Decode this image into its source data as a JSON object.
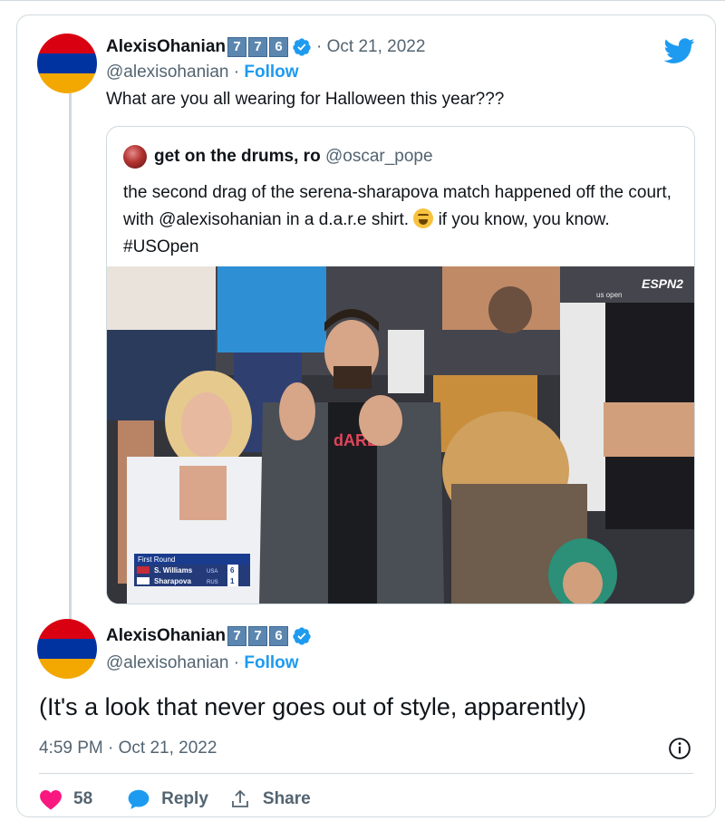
{
  "original_tweet": {
    "display_name": "AlexisOhanian",
    "number_badges": [
      "7",
      "7",
      "6"
    ],
    "handle": "@alexisohanian",
    "follow_label": "Follow",
    "date": "Oct 21, 2022",
    "text": "What are you all wearing for Halloween this year???",
    "quoted_tweet": {
      "display_name": "get on the drums, ro",
      "handle": "@oscar_pope",
      "text_before_emoji": "the second drag of the serena-sharapova match happened off the court, with @alexisohanian in a d.a.r.e shirt.",
      "text_after_emoji": "if you know, you know. #USOpen",
      "media": {
        "broadcast_logo": "ESPN2",
        "event_logo": "us open",
        "scoreboard": {
          "header": "First Round",
          "rows": [
            {
              "player": "S. Williams",
              "country": "USA",
              "score": "6"
            },
            {
              "player": "Sharapova",
              "country": "RUS",
              "score": "1"
            }
          ]
        },
        "shirt_text": "dARE"
      }
    }
  },
  "reply_tweet": {
    "display_name": "AlexisOhanian",
    "number_badges": [
      "7",
      "7",
      "6"
    ],
    "handle": "@alexisohanian",
    "follow_label": "Follow",
    "text": "(It's a look that never goes out of style, apparently)",
    "timestamp": "4:59 PM · Oct 21, 2022",
    "like_count": "58",
    "reply_label": "Reply",
    "share_label": "Share"
  },
  "colors": {
    "accent_blue": "#1d9bf0",
    "like_pink": "#f91880",
    "muted_text": "#536471",
    "badge_blue": "#5b86b0"
  },
  "icons": [
    "twitter-bird-icon",
    "verified-badge-icon",
    "info-icon",
    "heart-icon",
    "reply-bubble-icon",
    "share-icon"
  ]
}
